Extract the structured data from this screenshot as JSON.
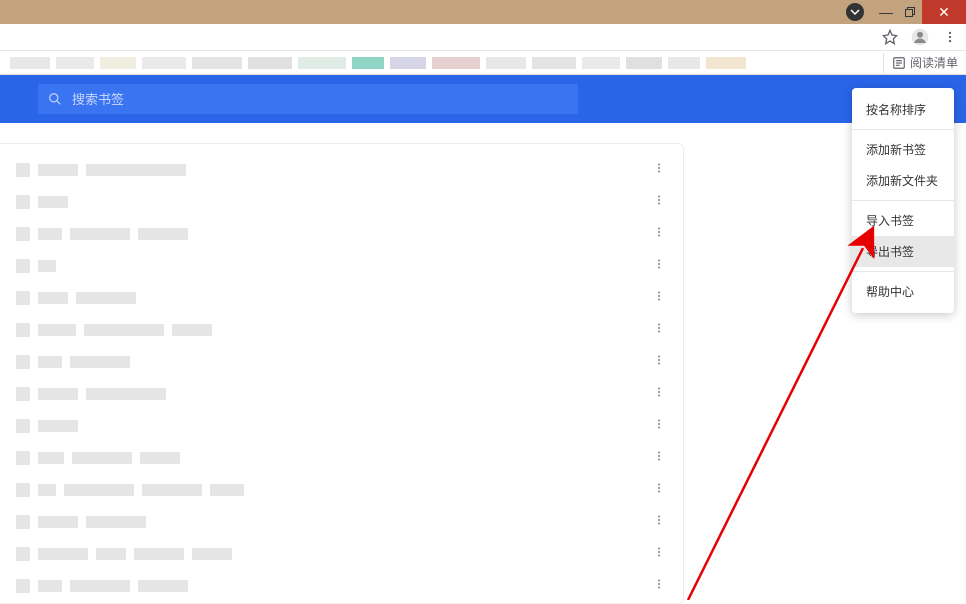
{
  "window": {
    "minimize": "—",
    "close": "✕"
  },
  "toolbar": {
    "reading_list_label": "阅读清单"
  },
  "search": {
    "placeholder": "搜索书签"
  },
  "bookmark_strip_widths": [
    40,
    38,
    36,
    44,
    50,
    44,
    48,
    32,
    36,
    48,
    40,
    44,
    38,
    36,
    32,
    40
  ],
  "bookmark_strip_colors": [
    "#e8e8e8",
    "#eaeaea",
    "#f0eee0",
    "#eaeaea",
    "#e4e4e4",
    "#e0e0e0",
    "#e0ece6",
    "#8fd4c4",
    "#d6d6e8",
    "#e6cfcf",
    "#e8e8e8",
    "#e4e4e4",
    "#eaeaea",
    "#e0e0e0",
    "#e8e8e8",
    "#f2e6d0"
  ],
  "context_menu": {
    "sort_by_name": "按名称排序",
    "add_bookmark": "添加新书签",
    "add_folder": "添加新文件夹",
    "import": "导入书签",
    "export": "导出书签",
    "help": "帮助中心"
  },
  "bookmark_rows": [
    [
      14,
      40,
      100
    ],
    [
      14,
      30
    ],
    [
      14,
      24,
      60,
      50
    ],
    [
      14,
      18
    ],
    [
      14,
      30,
      60
    ],
    [
      14,
      38,
      80,
      40
    ],
    [
      14,
      24,
      60
    ],
    [
      14,
      40,
      80
    ],
    [
      14,
      40
    ],
    [
      14,
      26,
      60,
      40
    ],
    [
      14,
      18,
      70,
      60,
      34
    ],
    [
      14,
      40,
      60
    ],
    [
      14,
      50,
      30,
      50,
      40
    ],
    [
      14,
      24,
      60,
      50
    ]
  ]
}
